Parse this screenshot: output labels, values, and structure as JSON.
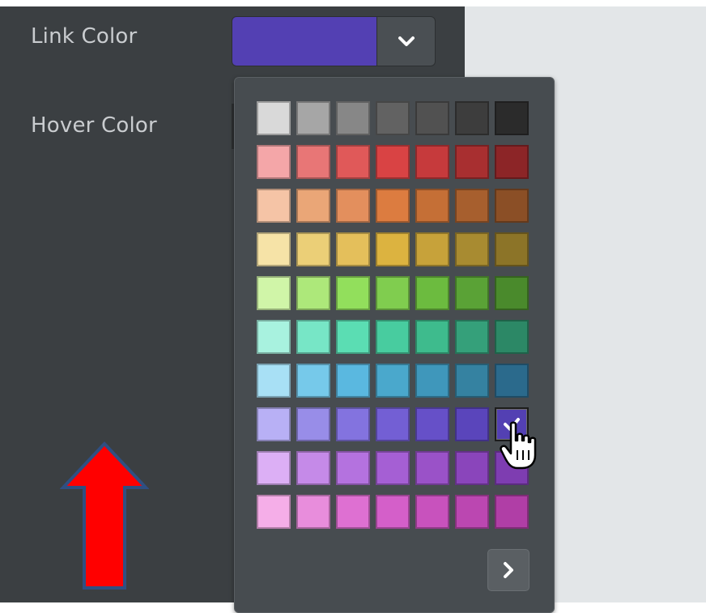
{
  "settings": {
    "link_color_label": "Link Color",
    "hover_color_label": "Hover Color",
    "link_color_value": "#5340b3"
  },
  "palette": {
    "rows": [
      [
        "#d9d9d9",
        "#a6a6a6",
        "#878787",
        "#626262",
        "#515151",
        "#3d3d3d",
        "#2b2b2b"
      ],
      [
        "#f4a6a8",
        "#e87676",
        "#e05959",
        "#d94344",
        "#c63a3c",
        "#a82f30",
        "#8c2527"
      ],
      [
        "#f5c4a6",
        "#eaa677",
        "#e38f5d",
        "#dc7c40",
        "#c56f36",
        "#a75f2e",
        "#8b4f26"
      ],
      [
        "#f6e3a7",
        "#ebcf77",
        "#e4bf5b",
        "#dcb340",
        "#c7a23a",
        "#a88b31",
        "#8c7428"
      ],
      [
        "#d0f5a8",
        "#ade87a",
        "#92df5c",
        "#80cd4f",
        "#6cbb3f",
        "#5aa236",
        "#4a8a2c"
      ],
      [
        "#a8f2df",
        "#77e6c6",
        "#5bddb3",
        "#48cc9f",
        "#3ebb8d",
        "#35a07a",
        "#2c8866"
      ],
      [
        "#a8e0f5",
        "#76c9ea",
        "#5ab8e0",
        "#4aa8cc",
        "#3f97bb",
        "#3582a1",
        "#2b6a8c"
      ],
      [
        "#b8b0f5",
        "#988de8",
        "#8373df",
        "#735fd4",
        "#6650c8",
        "#5a45bb",
        "#5340b3"
      ],
      [
        "#dcaff5",
        "#c58ae8",
        "#b472df",
        "#a55fd4",
        "#9a52c8",
        "#8a45bb",
        "#7e3db1"
      ],
      [
        "#f5aee8",
        "#e88ddc",
        "#de70d2",
        "#d45fc9",
        "#c852bd",
        "#bb47b1",
        "#b03ea6"
      ]
    ],
    "selected_color": "#5340b3"
  },
  "icons": {
    "dropdown": "chevron-down-icon",
    "next": "chevron-right-icon",
    "selected": "check-icon",
    "cursor": "hand-pointer-icon",
    "annotation": "up-arrow-annotation"
  },
  "colors": {
    "panel_bg": "#3b3f42",
    "popup_bg": "#474c50",
    "annotation_fill": "#ff0000",
    "annotation_stroke": "#2f4f82"
  }
}
